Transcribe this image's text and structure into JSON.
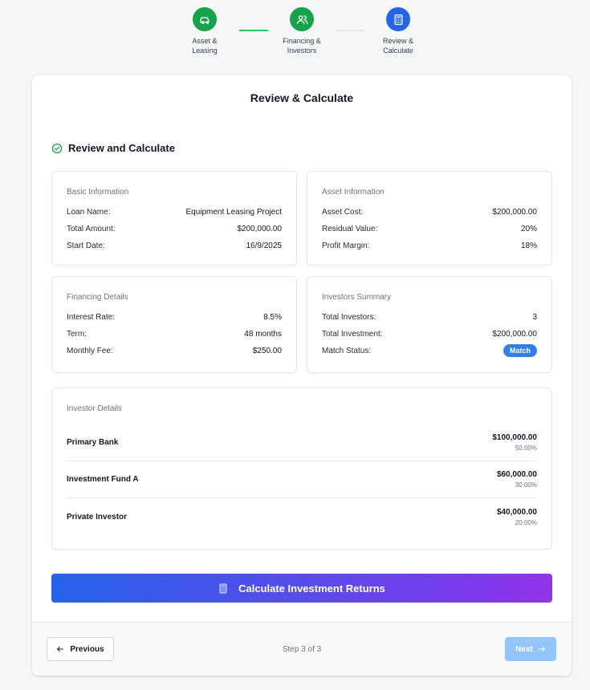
{
  "stepper": {
    "steps": [
      {
        "label_line1": "Asset &",
        "label_line2": "Leasing",
        "icon": "car-icon",
        "state": "done"
      },
      {
        "label_line1": "Financing &",
        "label_line2": "Investors",
        "icon": "users-icon",
        "state": "done"
      },
      {
        "label_line1": "Review &",
        "label_line2": "Calculate",
        "icon": "calculator-icon",
        "state": "active"
      }
    ]
  },
  "card": {
    "title": "Review & Calculate",
    "section_title": "Review and Calculate"
  },
  "basic_info": {
    "title": "Basic Information",
    "rows": [
      {
        "label": "Loan Name:",
        "value": "Equipment Leasing Project"
      },
      {
        "label": "Total Amount:",
        "value": "$200,000.00"
      },
      {
        "label": "Start Date:",
        "value": "16/9/2025"
      }
    ]
  },
  "asset_info": {
    "title": "Asset Information",
    "rows": [
      {
        "label": "Asset Cost:",
        "value": "$200,000.00"
      },
      {
        "label": "Residual Value:",
        "value": "20%"
      },
      {
        "label": "Profit Margin:",
        "value": "18%"
      }
    ]
  },
  "financing": {
    "title": "Financing Details",
    "rows": [
      {
        "label": "Interest Rate:",
        "value": "8.5%"
      },
      {
        "label": "Term:",
        "value": "48 months"
      },
      {
        "label": "Monthly Fee:",
        "value": "$250.00"
      }
    ]
  },
  "investors_summary": {
    "title": "Investors Summary",
    "rows": [
      {
        "label": "Total Investors:",
        "value": "3"
      },
      {
        "label": "Total Investment:",
        "value": "$200,000.00"
      }
    ],
    "match_label": "Match Status:",
    "match_badge": "Match"
  },
  "investor_details": {
    "title": "Investor Details",
    "items": [
      {
        "name": "Primary Bank",
        "amount": "$100,000.00",
        "percent": "50.00%"
      },
      {
        "name": "Investment Fund A",
        "amount": "$60,000.00",
        "percent": "30.00%"
      },
      {
        "name": "Private Investor",
        "amount": "$40,000.00",
        "percent": "20.00%"
      }
    ]
  },
  "calculate_button": "Calculate Investment Returns",
  "footer": {
    "previous": "Previous",
    "step_indicator": "Step 3 of 3",
    "next": "Next"
  },
  "colors": {
    "done": "#16a34a",
    "active": "#2563eb",
    "badge": "#2f80ed",
    "next_disabled": "#93c5fd"
  }
}
